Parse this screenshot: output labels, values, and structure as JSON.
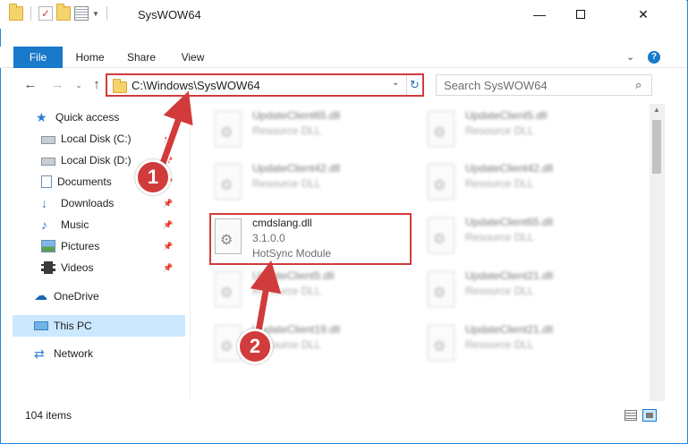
{
  "window": {
    "title": "SysWOW64",
    "minimize": "—",
    "close": "✕"
  },
  "ribbon": {
    "tabs": [
      {
        "label": "File"
      },
      {
        "label": "Home"
      },
      {
        "label": "Share"
      },
      {
        "label": "View"
      }
    ],
    "expand_glyph": "⌄",
    "help_glyph": "?"
  },
  "navigation": {
    "back_glyph": "←",
    "forward_glyph": "→",
    "recent_glyph": "⌄",
    "up_glyph": "↑"
  },
  "address_bar": {
    "path": "C:\\Windows\\SysWOW64",
    "dropdown_glyph": "⌄",
    "refresh_glyph": "↻"
  },
  "search": {
    "placeholder": "Search SysWOW64",
    "icon_glyph": "⌕"
  },
  "nav_pane": {
    "items": [
      {
        "label": "Quick access",
        "icon": "star-icon",
        "pinned": false
      },
      {
        "label": "Local Disk (C:)",
        "icon": "drive-icon",
        "pinned": true
      },
      {
        "label": "Local Disk (D:)",
        "icon": "drive-icon",
        "pinned": true
      },
      {
        "label": "Documents",
        "icon": "documents-icon",
        "pinned": true
      },
      {
        "label": "Downloads",
        "icon": "downloads-icon",
        "pinned": true
      },
      {
        "label": "Music",
        "icon": "music-icon",
        "pinned": true
      },
      {
        "label": "Pictures",
        "icon": "pictures-icon",
        "pinned": true
      },
      {
        "label": "Videos",
        "icon": "videos-icon",
        "pinned": true
      },
      {
        "label": "OneDrive",
        "icon": "onedrive-icon",
        "pinned": false
      },
      {
        "label": "This PC",
        "icon": "this-pc-icon",
        "pinned": false,
        "selected": true
      },
      {
        "label": "Network",
        "icon": "network-icon",
        "pinned": false
      }
    ],
    "pin_glyph": "📌"
  },
  "files": {
    "highlighted": {
      "name": "cmdslang.dll",
      "version": "3.1.0.0",
      "description": "HotSync Module"
    },
    "background": [
      {
        "name": "UpdateClient65.dll",
        "type": "Resource DLL"
      },
      {
        "name": "UpdateClient5.dll",
        "type": "Resource DLL"
      },
      {
        "name": "UpdateClient42.dll",
        "type": "Resource DLL"
      },
      {
        "name": "UpdateClient42.dll",
        "type": "Resource DLL"
      },
      {
        "name": "UpdateClient65.dll",
        "type": "Resource DLL"
      },
      {
        "name": "UpdateClient5.dll",
        "type": "Resource DLL"
      },
      {
        "name": "UpdateClient21.dll",
        "type": "Resource DLL"
      },
      {
        "name": "UpdateClient19.dll",
        "type": "Resource DLL"
      },
      {
        "name": "UpdateClient21.dll",
        "type": "Resource DLL"
      }
    ]
  },
  "status_bar": {
    "item_count": "104 items"
  },
  "annotations": {
    "step1": "1",
    "step2": "2",
    "color": "#d23b3b"
  },
  "colors": {
    "accent": "#1979ca",
    "selection": "#cce8ff"
  }
}
